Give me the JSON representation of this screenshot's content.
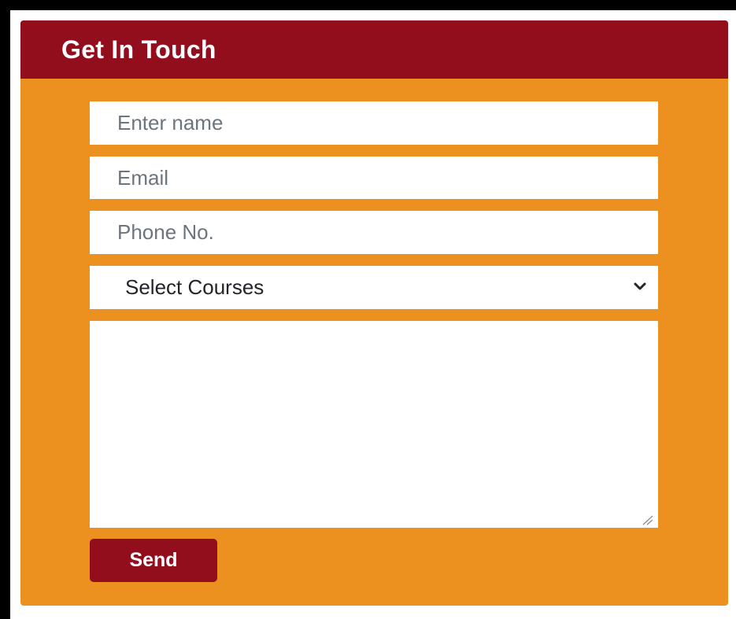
{
  "form": {
    "title": "Get In Touch",
    "name_placeholder": "Enter name",
    "email_placeholder": "Email",
    "phone_placeholder": "Phone No.",
    "course_select": {
      "selected": "Select Courses",
      "options": [
        "Select Courses"
      ]
    },
    "message_value": "",
    "send_label": "Send"
  },
  "icons": {
    "select_arrow": "chevron-down-icon",
    "textarea_corner": "resize-handle-icon"
  },
  "colors": {
    "header_background": "#930e1d",
    "card_background": "#ec9020",
    "button_background": "#930e1d",
    "field_background": "#ffffff",
    "outer_border": "#000000"
  }
}
